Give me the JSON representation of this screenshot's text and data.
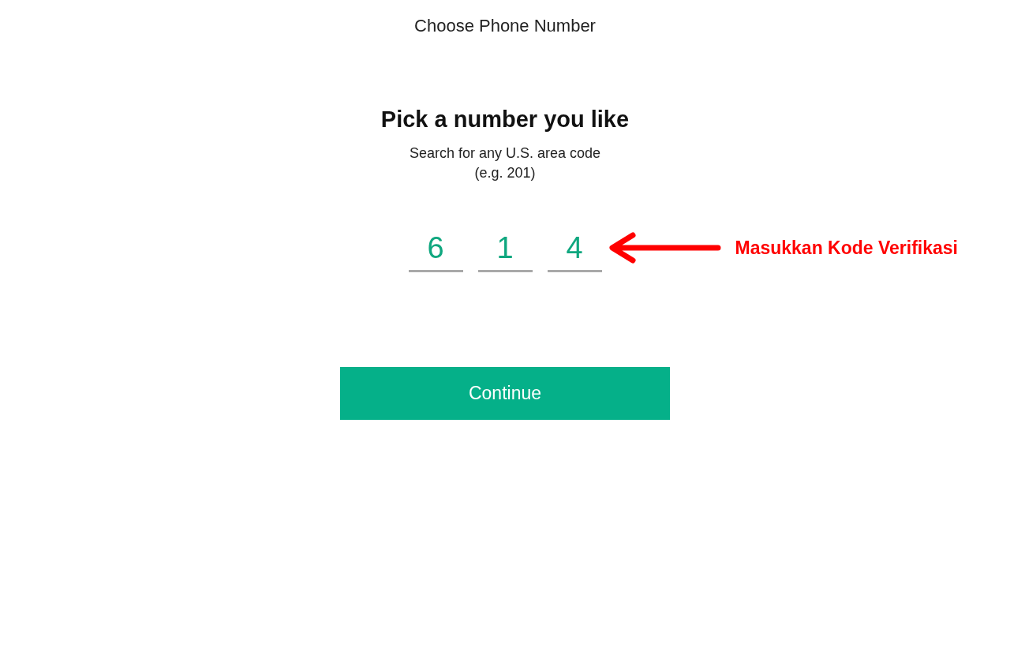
{
  "header": {
    "title": "Choose Phone Number"
  },
  "heading": "Pick a number you like",
  "subtitle": [
    "Search for any U.S. area code",
    "(e.g. 201)"
  ],
  "area_code": [
    {
      "value": "6"
    },
    {
      "value": "1"
    },
    {
      "value": "4"
    }
  ],
  "annotation": {
    "text": "Masukkan Kode Verifikasi"
  },
  "button": {
    "label": "Continue"
  }
}
